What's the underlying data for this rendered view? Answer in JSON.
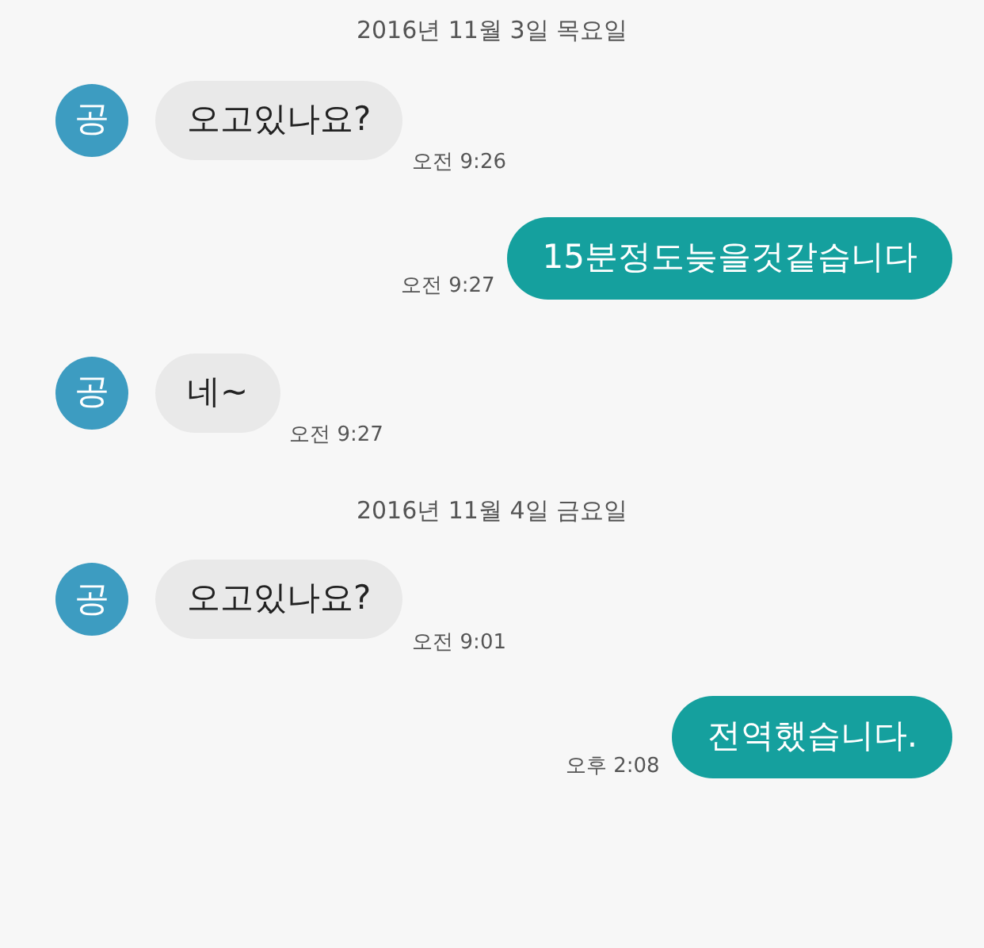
{
  "messages": [
    {
      "kind": "date",
      "text": "2016년 11월 3일 목요일"
    },
    {
      "kind": "in",
      "avatar": "공",
      "text": "오고있나요?",
      "time": "오전 9:26"
    },
    {
      "kind": "out",
      "text": "15분정도늦을것같습니다",
      "time": "오전 9:27"
    },
    {
      "kind": "in",
      "avatar": "공",
      "text": "네~",
      "time": "오전 9:27"
    },
    {
      "kind": "date",
      "text": "2016년 11월 4일 금요일"
    },
    {
      "kind": "in",
      "avatar": "공",
      "text": "오고있나요?",
      "time": "오전 9:01"
    },
    {
      "kind": "out",
      "text": "전역했습니다.",
      "time": "오후 2:08"
    }
  ]
}
